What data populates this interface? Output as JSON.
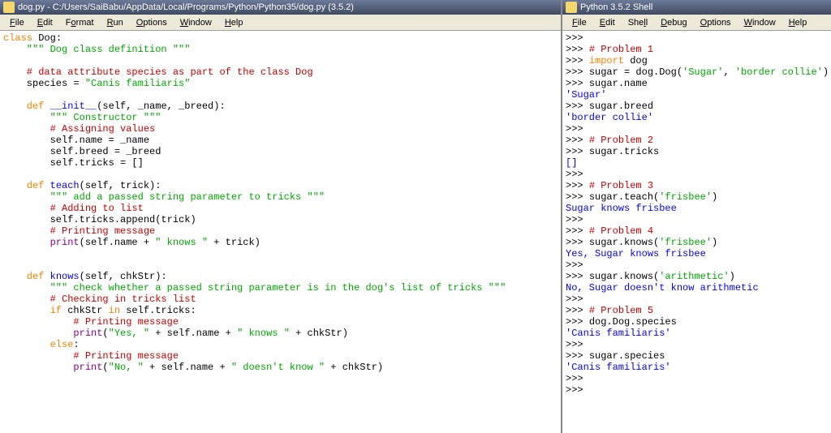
{
  "left": {
    "title": "dog.py - C:/Users/SaiBabu/AppData/Local/Programs/Python/Python35/dog.py (3.5.2)",
    "menu": [
      "File",
      "Edit",
      "Format",
      "Run",
      "Options",
      "Window",
      "Help"
    ],
    "code": {
      "l1": "class",
      "l1b": " Dog:",
      "l2": "    \"\"\" Dog class definition \"\"\"",
      "l3": "    # data attribute species as part of the class Dog",
      "l4a": "    species = ",
      "l4b": "\"Canis familiaris\"",
      "l5a": "    def",
      "l5b": " __init__",
      "l5c": "(self, _name, _breed):",
      "l6": "        \"\"\" Constructor \"\"\"",
      "l7": "        # Assigning values",
      "l8": "        self.name = _name",
      "l9": "        self.breed = _breed",
      "l10": "        self.tricks = []",
      "l11a": "    def",
      "l11b": " teach",
      "l11c": "(self, trick):",
      "l12": "        \"\"\" add a passed string parameter to tricks \"\"\"",
      "l13": "        # Adding to list",
      "l14": "        self.tricks.append(trick)",
      "l15": "        # Printing message",
      "l16a": "        print",
      "l16b": "(self.name + ",
      "l16c": "\" knows \"",
      "l16d": " + trick)",
      "l17a": "    def",
      "l17b": " knows",
      "l17c": "(self, chkStr):",
      "l18": "        \"\"\" check whether a passed string parameter is in the dog's list of tricks \"\"\"",
      "l19": "        # Checking in tricks list",
      "l20a": "        if",
      "l20b": " chkStr ",
      "l20c": "in",
      "l20d": " self.tricks:",
      "l21": "            # Printing message",
      "l22a": "            print",
      "l22b": "(",
      "l22c": "\"Yes, \"",
      "l22d": " + self.name + ",
      "l22e": "\" knows \"",
      "l22f": " + chkStr)",
      "l23a": "        else",
      "l23b": ":",
      "l24": "            # Printing message",
      "l25a": "            print",
      "l25b": "(",
      "l25c": "\"No, \"",
      "l25d": " + self.name + ",
      "l25e": "\" doesn't know \"",
      "l25f": " + chkStr)"
    }
  },
  "right": {
    "title": "Python 3.5.2 Shell",
    "menu": [
      "File",
      "Edit",
      "Shell",
      "Debug",
      "Options",
      "Window",
      "Help"
    ],
    "shell": {
      "p": ">>> ",
      "c1": "# Problem 1",
      "l2a": "import",
      "l2b": " dog",
      "l3a": "sugar = dog.Dog(",
      "l3b": "'Sugar'",
      "l3c": ", ",
      "l3d": "'border collie'",
      "l3e": ")",
      "l4": "sugar.name",
      "o1": "'Sugar'",
      "l5": "sugar.breed",
      "o2": "'border collie'",
      "c2": "# Problem 2",
      "l6": "sugar.tricks",
      "o3": "[]",
      "c3": "# Problem 3",
      "l7a": "sugar.teach(",
      "l7b": "'frisbee'",
      "l7c": ")",
      "o4": "Sugar knows frisbee",
      "c4": "# Problem 4",
      "l8a": "sugar.knows(",
      "l8b": "'frisbee'",
      "l8c": ")",
      "o5": "Yes, Sugar knows frisbee",
      "l9a": "sugar.knows(",
      "l9b": "'arithmetic'",
      "l9c": ")",
      "o6": "No, Sugar doesn't know arithmetic",
      "c5": "# Problem 5",
      "l10": "dog.Dog.species",
      "o7": "'Canis familiaris'",
      "l11": "sugar.species",
      "o8": "'Canis familiaris'"
    }
  }
}
